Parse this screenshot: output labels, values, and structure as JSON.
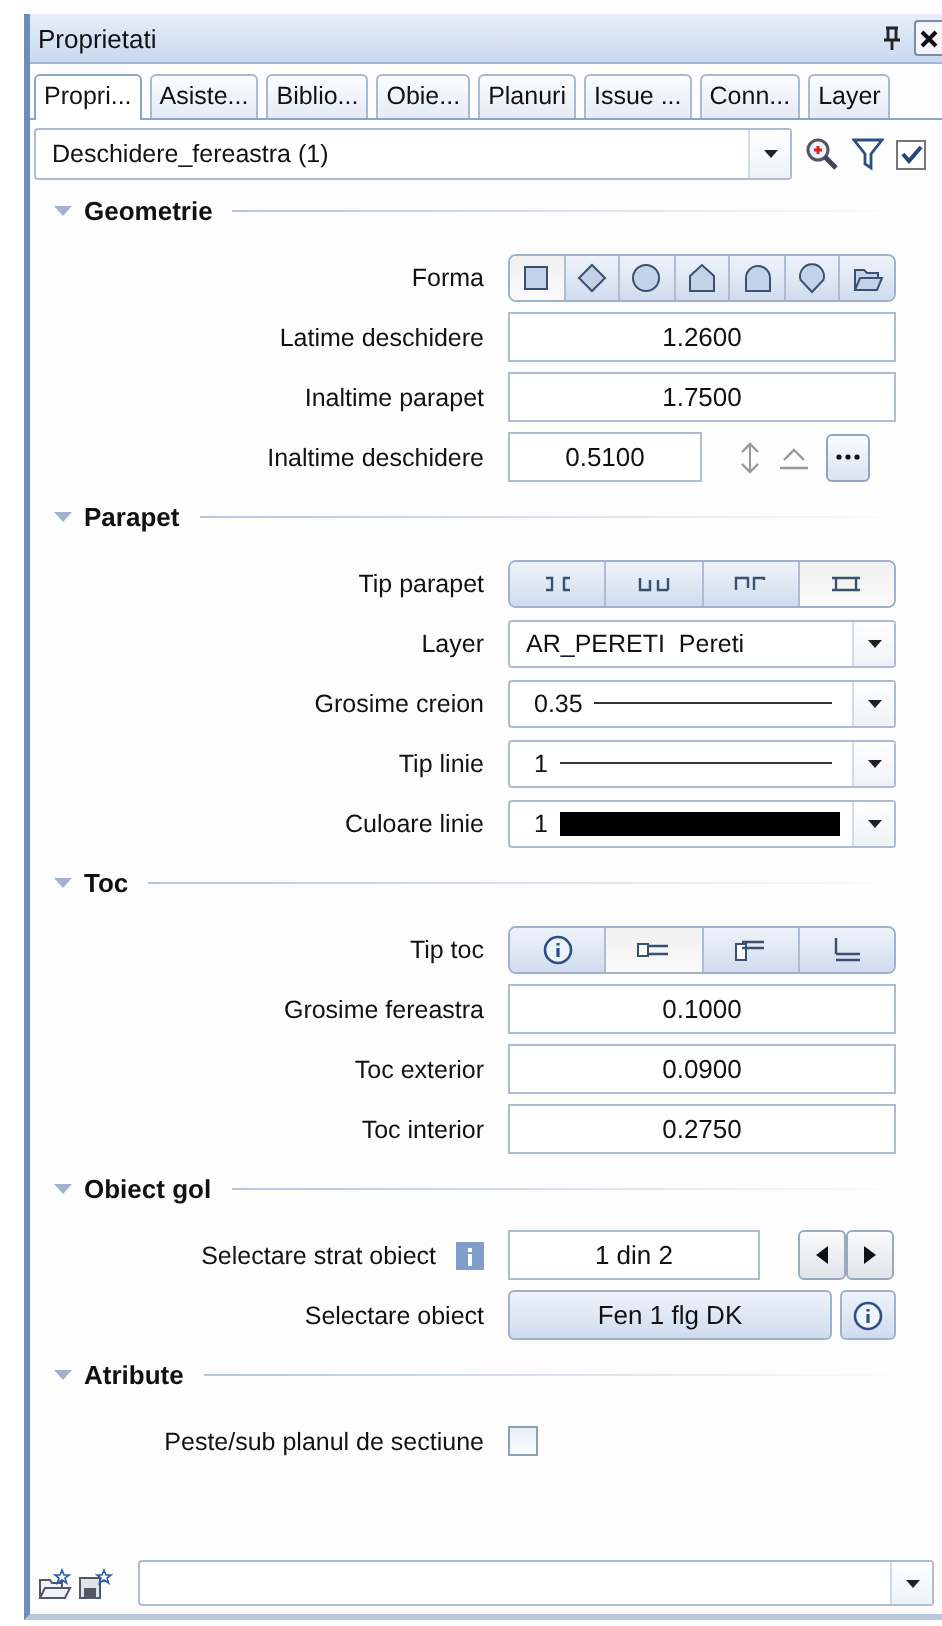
{
  "panel": {
    "title": "Proprietati"
  },
  "tabs": [
    {
      "label": "Propri...",
      "selected": true
    },
    {
      "label": "Asiste...",
      "selected": false
    },
    {
      "label": "Biblio...",
      "selected": false
    },
    {
      "label": "Obie...",
      "selected": false
    },
    {
      "label": "Planuri",
      "selected": false
    },
    {
      "label": "Issue ...",
      "selected": false
    },
    {
      "label": "Conn...",
      "selected": false
    },
    {
      "label": "Layer",
      "selected": false
    }
  ],
  "object_selector": {
    "value": "Deschidere_fereastra (1)",
    "toggle_checked": true
  },
  "sections": [
    {
      "title": "Geometrie",
      "expanded": true,
      "rows": [
        {
          "kind": "shape_picker",
          "label": "Forma",
          "options": [
            {
              "selected": true
            },
            {
              "selected": false
            },
            {
              "selected": false
            },
            {
              "selected": false
            },
            {
              "selected": false
            },
            {
              "selected": false
            },
            {
              "selected": false
            }
          ]
        },
        {
          "kind": "text",
          "label": "Latime deschidere",
          "value": "1.2600"
        },
        {
          "kind": "text",
          "label": "Inaltime parapet",
          "value": "1.7500"
        },
        {
          "kind": "text_tools",
          "label": "Inaltime deschidere",
          "value": "0.5100"
        }
      ]
    },
    {
      "title": "Parapet",
      "expanded": true,
      "rows": [
        {
          "kind": "parapet_picker",
          "label": "Tip parapet",
          "options": [
            {
              "selected": false
            },
            {
              "selected": false
            },
            {
              "selected": false
            },
            {
              "selected": true
            }
          ]
        },
        {
          "kind": "dropdown",
          "label": "Layer",
          "value": "AR_PERETI  Pereti"
        },
        {
          "kind": "dropdown_line",
          "label": "Grosime creion",
          "value": "0.35"
        },
        {
          "kind": "dropdown_line",
          "label": "Tip linie",
          "value": "1"
        },
        {
          "kind": "dropdown_swatch",
          "label": "Culoare linie",
          "value": "1"
        }
      ]
    },
    {
      "title": "Toc",
      "expanded": true,
      "rows": [
        {
          "kind": "frame_picker",
          "label": "Tip toc",
          "options": [
            {
              "selected": false
            },
            {
              "selected": true
            },
            {
              "selected": false
            },
            {
              "selected": false
            }
          ]
        },
        {
          "kind": "text",
          "label": "Grosime fereastra",
          "value": "0.1000"
        },
        {
          "kind": "text",
          "label": "Toc exterior",
          "value": "0.0900"
        },
        {
          "kind": "text",
          "label": "Toc interior",
          "value": "0.2750"
        }
      ]
    },
    {
      "title": "Obiect gol",
      "expanded": true,
      "rows": [
        {
          "kind": "stepper",
          "label": "Selectare strat obiect",
          "value": "1 din 2"
        },
        {
          "kind": "button",
          "label": "Selectare obiect",
          "value": "Fen 1 flg DK"
        }
      ]
    },
    {
      "title": "Atribute",
      "expanded": true,
      "rows": [
        {
          "kind": "checkbox",
          "label": "Peste/sub planul de sectiune",
          "checked": false
        }
      ]
    }
  ]
}
